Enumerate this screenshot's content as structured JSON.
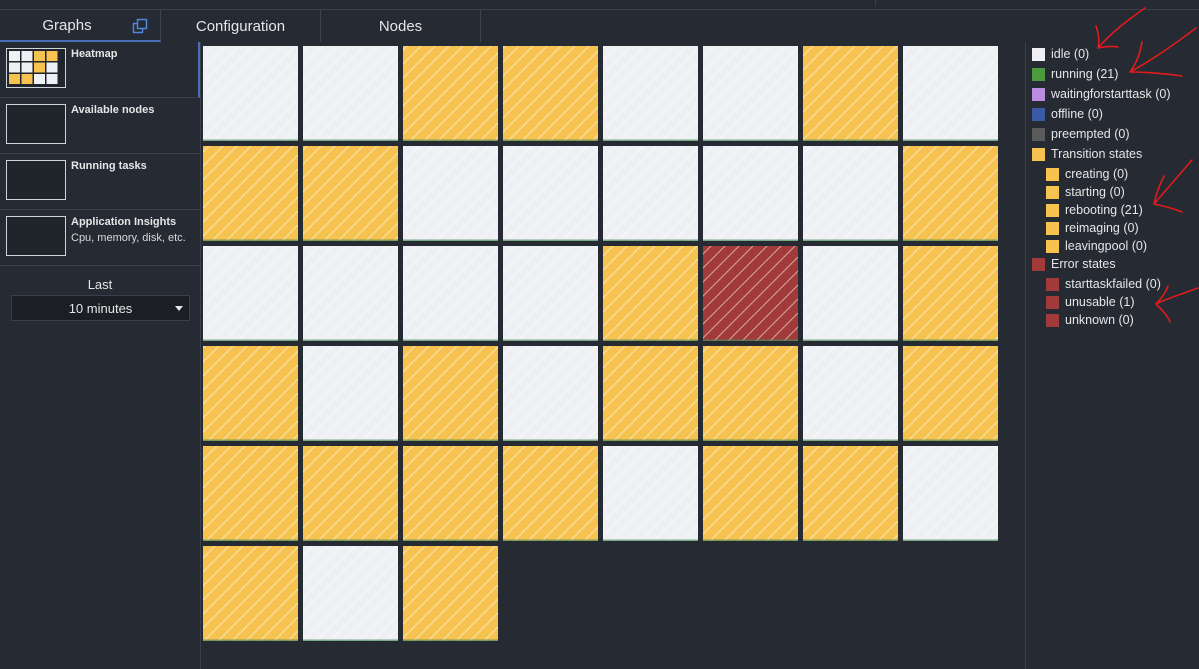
{
  "tabs": [
    {
      "label": "Graphs",
      "active": true
    },
    {
      "label": "Configuration",
      "active": false
    },
    {
      "label": "Nodes",
      "active": false
    }
  ],
  "sidebar": {
    "items": [
      {
        "title": "Heatmap",
        "subtitle": ""
      },
      {
        "title": "Available nodes",
        "subtitle": ""
      },
      {
        "title": "Running tasks",
        "subtitle": ""
      },
      {
        "title": "Application Insights",
        "subtitle": "Cpu, memory, disk, etc."
      }
    ],
    "last_label": "Last",
    "range_value": "10 minutes"
  },
  "colors": {
    "idle": "#eef0f3",
    "transition": "#f6c350",
    "error": "#a33a3a",
    "running": "#4e9a3e",
    "waiting": "#b98ce0",
    "offline": "#3b5aa6",
    "preempted": "#5a5a5a",
    "annotation": "#e01b1b"
  },
  "heatmap": {
    "columns": 8,
    "nodes": [
      "idle",
      "idle",
      "transition",
      "transition",
      "idle",
      "idle",
      "transition",
      "idle",
      "transition",
      "transition",
      "idle",
      "idle",
      "idle",
      "idle",
      "idle",
      "transition",
      "idle",
      "idle",
      "idle",
      "idle",
      "transition",
      "error",
      "idle",
      "transition",
      "transition",
      "idle",
      "transition",
      "idle",
      "transition",
      "transition",
      "idle",
      "transition",
      "transition",
      "transition",
      "transition",
      "transition",
      "idle",
      "transition",
      "transition",
      "idle",
      "transition",
      "idle",
      "transition"
    ]
  },
  "legend": {
    "items": [
      {
        "label": "idle (0)",
        "color": "#eef0f3",
        "indent": false
      },
      {
        "label": "running (21)",
        "color": "#4e9a3e",
        "indent": false
      },
      {
        "label": "waitingforstarttask (0)",
        "color": "#b98ce0",
        "indent": false
      },
      {
        "label": "offline (0)",
        "color": "#3b5aa6",
        "indent": false
      },
      {
        "label": "preempted (0)",
        "color": "#5a5a5a",
        "indent": false
      },
      {
        "label": "Transition states",
        "color": "#f6c350",
        "indent": false
      },
      {
        "label": "creating (0)",
        "color": "#f6c350",
        "indent": true
      },
      {
        "label": "starting (0)",
        "color": "#f6c350",
        "indent": true
      },
      {
        "label": "rebooting (21)",
        "color": "#f6c350",
        "indent": true
      },
      {
        "label": "reimaging (0)",
        "color": "#f6c350",
        "indent": true
      },
      {
        "label": "leavingpool (0)",
        "color": "#f6c350",
        "indent": true
      },
      {
        "label": "Error states",
        "color": "#a33a3a",
        "indent": false
      },
      {
        "label": "starttaskfailed (0)",
        "color": "#a33a3a",
        "indent": true
      },
      {
        "label": "unusable (1)",
        "color": "#a33a3a",
        "indent": true
      },
      {
        "label": "unknown (0)",
        "color": "#a33a3a",
        "indent": true
      }
    ]
  }
}
